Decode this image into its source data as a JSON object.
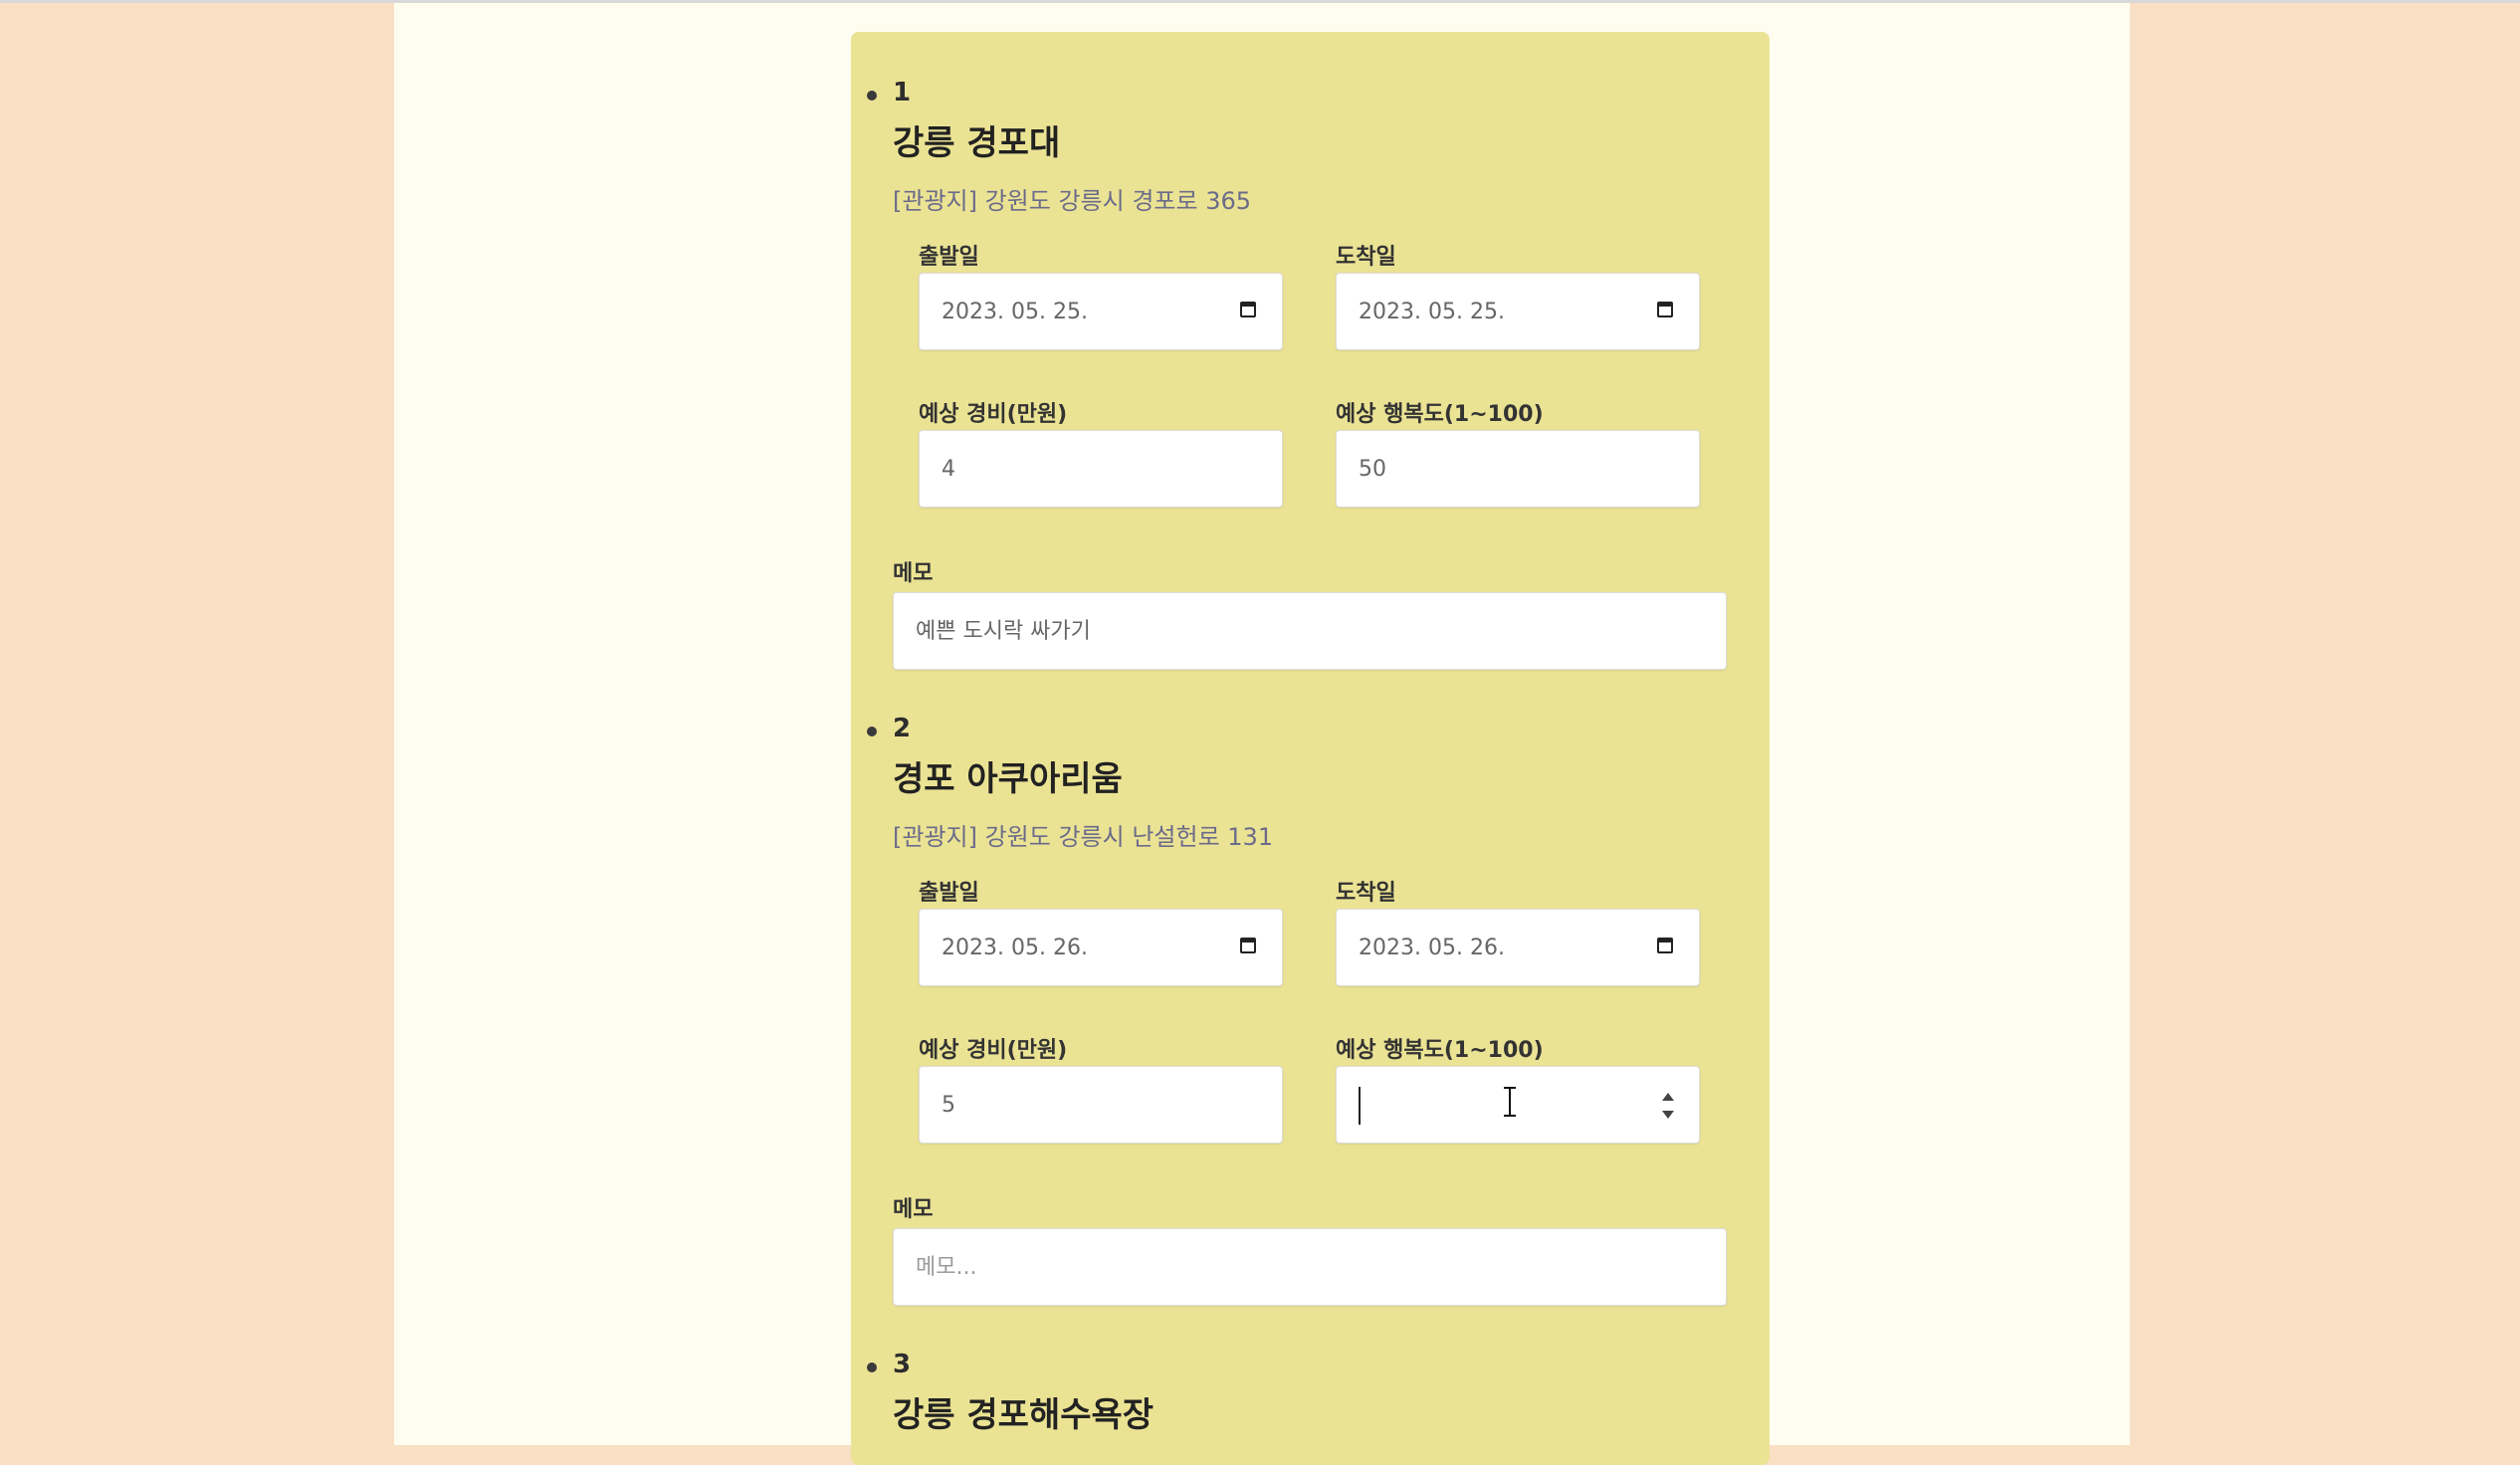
{
  "labels": {
    "start_date": "출발일",
    "arrival_date": "도착일",
    "budget": "예상 경비(만원)",
    "happiness": "예상 행복도(1~100)",
    "memo": "메모"
  },
  "icons": {
    "date": "calendar-icon",
    "spinner": "number-spinner-icon",
    "cursor": "text-cursor-icon"
  },
  "colors": {
    "background": "#f9dfc4",
    "page": "#fffdf0",
    "panel": "#ebe394",
    "address": "#6b6b8a"
  },
  "items": [
    {
      "number": "1",
      "title": "강릉 경포대",
      "address": "[관광지] 강원도 강릉시 경포로 365",
      "start_date": "2023. 05. 25.",
      "arrival_date": "2023. 05. 25.",
      "budget": "4",
      "happiness": "50",
      "memo": "예쁜 도시락 싸가기",
      "memo_placeholder": "메모..."
    },
    {
      "number": "2",
      "title": "경포 아쿠아리움",
      "address": "[관광지] 강원도 강릉시 난설헌로 131",
      "start_date": "2023. 05. 26.",
      "arrival_date": "2023. 05. 26.",
      "budget": "5",
      "happiness": "",
      "memo": "",
      "memo_placeholder": "메모..."
    },
    {
      "number": "3",
      "title": "강릉 경포해수욕장"
    }
  ]
}
